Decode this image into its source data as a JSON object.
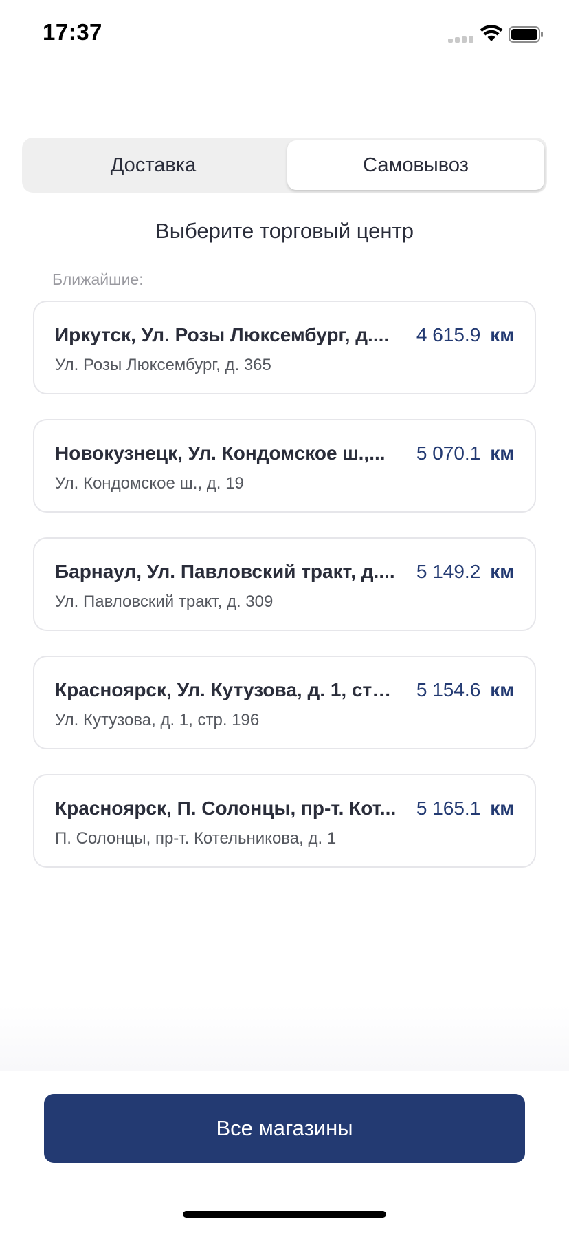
{
  "status_bar": {
    "time": "17:37"
  },
  "tabs": [
    {
      "label": "Доставка",
      "selected": false
    },
    {
      "label": "Самовывоз",
      "selected": true
    }
  ],
  "heading": "Выберите торговый центр",
  "nearest_label": "Ближайшие:",
  "stores": [
    {
      "name": "Иркутск, Ул. Розы Люксембург, д....",
      "address": "Ул. Розы Люксембург, д. 365",
      "distance": "4 615.9",
      "unit": "км"
    },
    {
      "name": "Новокузнецк, Ул. Кондомское ш.,...",
      "address": "Ул. Кондомское ш., д. 19",
      "distance": "5 070.1",
      "unit": "км"
    },
    {
      "name": "Барнаул, Ул. Павловский тракт, д....",
      "address": "Ул. Павловский тракт, д. 309",
      "distance": "5 149.2",
      "unit": "км"
    },
    {
      "name": "Красноярск, Ул. Кутузова, д. 1, стр...",
      "address": "Ул. Кутузова, д. 1, стр. 196",
      "distance": "5 154.6",
      "unit": "км"
    },
    {
      "name": "Красноярск, П. Солонцы, пр-т. Кот...",
      "address": "П. Солонцы, пр-т. Котельникова, д. 1",
      "distance": "5 165.1",
      "unit": "км"
    }
  ],
  "all_stores_button": "Все магазины",
  "colors": {
    "accent": "#233a72",
    "text": "#2a2d3a",
    "muted": "#9a9aa0"
  }
}
